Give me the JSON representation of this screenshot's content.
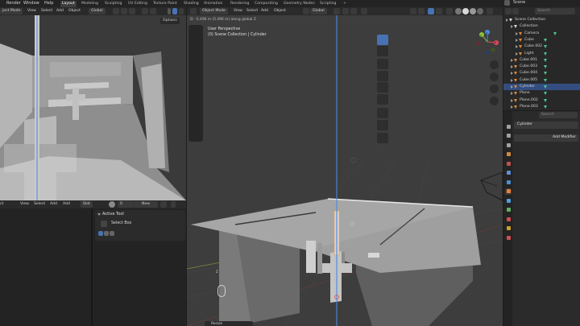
{
  "topbar": {
    "menus": [
      "Render",
      "Window",
      "Help"
    ],
    "workspaces": [
      "Layout",
      "Modeling",
      "Sculpting",
      "UV Editing",
      "Texture Paint",
      "Shading",
      "Animation",
      "Rendering",
      "Compositing",
      "Geometry Nodes",
      "Scripting"
    ],
    "active_workspace": "Layout",
    "add_tab": "+",
    "scene_label": "Scene"
  },
  "left_viewport": {
    "header": {
      "mode": "ject Mode",
      "menus": [
        "View",
        "Select",
        "Add",
        "Object"
      ],
      "orientation": "Global",
      "options": "Options"
    }
  },
  "text_editor": {
    "header": {
      "editor": "ct",
      "menus": [
        "View",
        "Select",
        "Add",
        "Add"
      ],
      "slot": "Slot",
      "field": "0",
      "new_button": "New"
    },
    "panel_title": "Active Tool",
    "tool_name": "Select Box"
  },
  "main_viewport": {
    "header": {
      "mode": "Object Mode",
      "menus": [
        "View",
        "Select",
        "Add",
        "Object"
      ],
      "orientation": "Global"
    },
    "status_line": "D: -5.496 m (5.496 m) along global Z",
    "perspective": "User Perspective",
    "collection": "(0) Scene Collection | Cylinder",
    "gizmo": {
      "x": "X",
      "y": "Y",
      "z": "Z"
    },
    "bottom_popup": "Resize"
  },
  "outliner": {
    "search_placeholder": "Search",
    "items": [
      {
        "label": "Scene Collection",
        "indent": 0,
        "icon": "collection-icon",
        "selected": false
      },
      {
        "label": "Collection",
        "indent": 1,
        "icon": "collection-icon",
        "selected": false
      },
      {
        "label": "Camera",
        "indent": 2,
        "icon": "camera-icon",
        "selected": false
      },
      {
        "label": "Cube",
        "indent": 2,
        "icon": "mesh-icon",
        "selected": false
      },
      {
        "label": "Cube.002",
        "indent": 2,
        "icon": "mesh-icon",
        "selected": false
      },
      {
        "label": "Light",
        "indent": 2,
        "icon": "light-icon",
        "selected": false
      },
      {
        "label": "Cube.001",
        "indent": 1,
        "icon": "mesh-icon",
        "selected": false
      },
      {
        "label": "Cube.003",
        "indent": 1,
        "icon": "mesh-icon",
        "selected": false
      },
      {
        "label": "Cube.004",
        "indent": 1,
        "icon": "mesh-icon",
        "selected": false
      },
      {
        "label": "Cube.005",
        "indent": 1,
        "icon": "mesh-icon",
        "selected": false
      },
      {
        "label": "Cylinder",
        "indent": 1,
        "icon": "mesh-icon",
        "selected": true
      },
      {
        "label": "Plane",
        "indent": 1,
        "icon": "mesh-icon",
        "selected": false
      },
      {
        "label": "Plane.002",
        "indent": 1,
        "icon": "mesh-icon",
        "selected": false
      },
      {
        "label": "Plane.003",
        "indent": 1,
        "icon": "mesh-icon",
        "selected": false
      }
    ]
  },
  "properties": {
    "search_placeholder": "Search",
    "object_name": "Cylinder",
    "add_modifier": "Add Modifier",
    "tab_colors": [
      "#a0a0a0",
      "#a0a0a0",
      "#a0a0a0",
      "#d08a3a",
      "#c05050",
      "#5e8fd8",
      "#4a90d0",
      "#f08030",
      "#4ea0e0",
      "#60b060",
      "#d04a4a",
      "#c9a227",
      "#d05050"
    ]
  },
  "colors": {
    "accent": "#4772b3",
    "selected_row": "#334d80",
    "x_axis": "#e04a5a",
    "y_axis": "#8cc43c",
    "z_axis": "#4a88e0",
    "mesh_icon": "#e08b3a",
    "vis_icon": "#4fc48e"
  }
}
